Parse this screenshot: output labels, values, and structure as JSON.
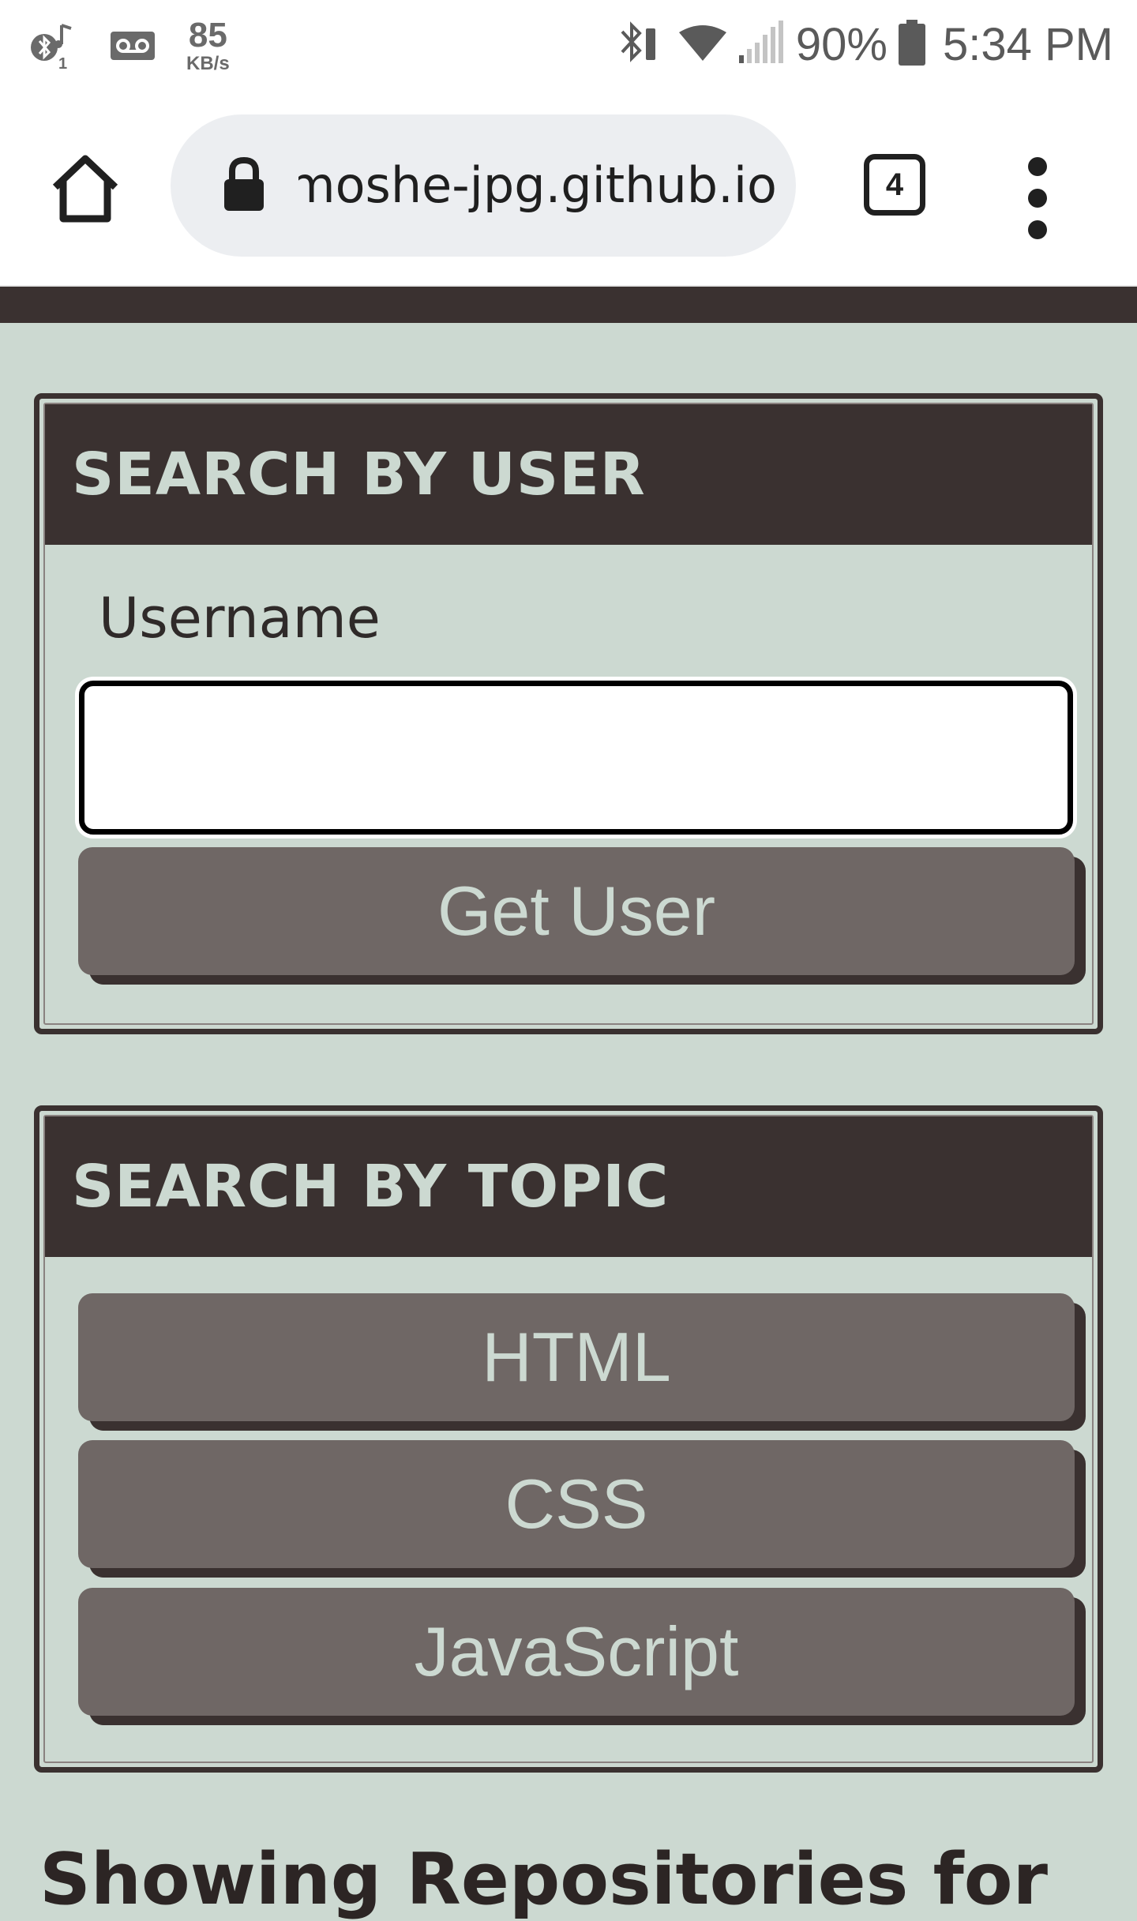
{
  "status_bar": {
    "speed_value": "85",
    "speed_unit": "KB/s",
    "bluetooth_badge": "1",
    "battery_percent": "90%",
    "time": "5:34 PM",
    "icons": [
      "bluetooth-music-icon",
      "voicemail-icon",
      "bluetooth-icon",
      "wifi-icon",
      "cell-signal-icon",
      "battery-icon"
    ]
  },
  "browser": {
    "url": "moshe-jpg.github.io",
    "tab_count": "4",
    "icons": [
      "home-icon",
      "lock-icon",
      "tabs-icon",
      "more-vert-icon"
    ]
  },
  "search_user": {
    "title": "SEARCH BY USER",
    "username_label": "Username",
    "username_value": "",
    "button_label": "Get User"
  },
  "search_topic": {
    "title": "SEARCH BY TOPIC",
    "buttons": [
      {
        "label": "HTML"
      },
      {
        "label": "CSS"
      },
      {
        "label": "JavaScript"
      }
    ]
  },
  "next_section": {
    "heading_partial": "Showing Repositories for"
  },
  "colors": {
    "background": "#ccd9d1",
    "dark": "#3a3130",
    "button": "#6f6765",
    "button_text": "#ccd9d1"
  }
}
